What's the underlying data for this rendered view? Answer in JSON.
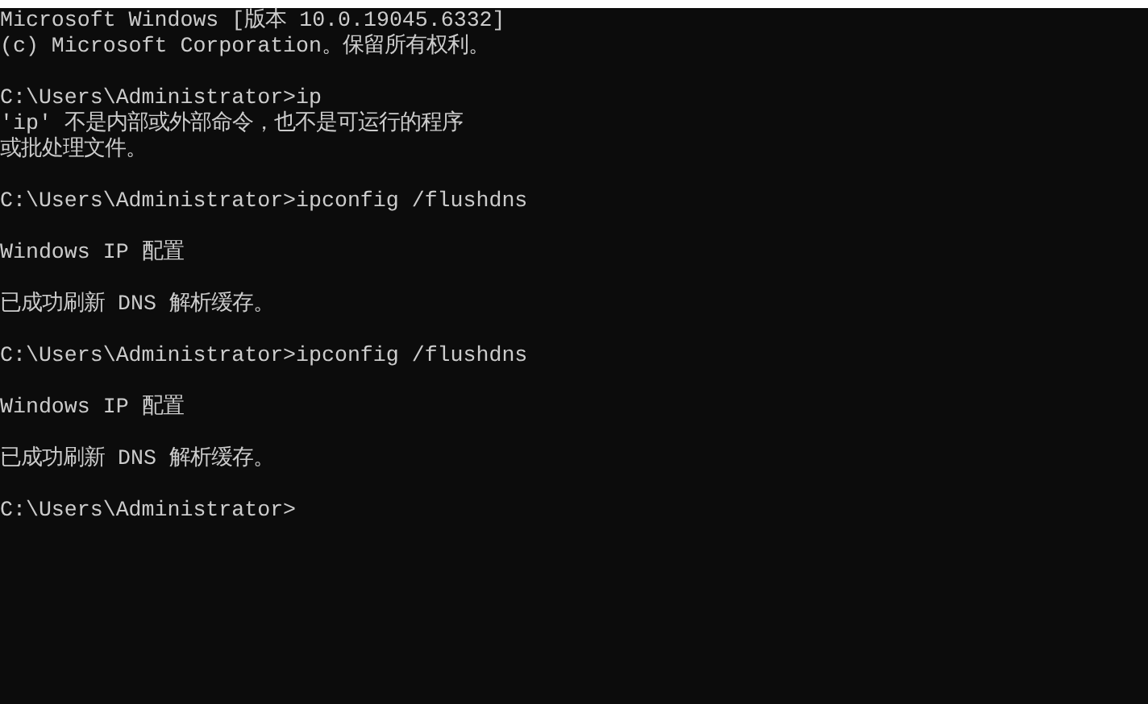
{
  "console": {
    "lines": [
      {
        "kind": "text",
        "text": "Microsoft Windows [版本 10.0.19045.6332]"
      },
      {
        "kind": "text",
        "text": "(c) Microsoft Corporation。保留所有权利。"
      },
      {
        "kind": "blank"
      },
      {
        "kind": "text",
        "text": "C:\\Users\\Administrator>ip"
      },
      {
        "kind": "text",
        "text": "'ip' 不是内部或外部命令，也不是可运行的程序"
      },
      {
        "kind": "text",
        "text": "或批处理文件。"
      },
      {
        "kind": "blank"
      },
      {
        "kind": "text",
        "text": "C:\\Users\\Administrator>ipconfig /flushdns"
      },
      {
        "kind": "blank"
      },
      {
        "kind": "text",
        "text": "Windows IP 配置"
      },
      {
        "kind": "blank"
      },
      {
        "kind": "text",
        "text": "已成功刷新 DNS 解析缓存。"
      },
      {
        "kind": "blank"
      },
      {
        "kind": "text",
        "text": "C:\\Users\\Administrator>ipconfig /flushdns"
      },
      {
        "kind": "blank"
      },
      {
        "kind": "text",
        "text": "Windows IP 配置"
      },
      {
        "kind": "blank"
      },
      {
        "kind": "text",
        "text": "已成功刷新 DNS 解析缓存。"
      },
      {
        "kind": "blank"
      },
      {
        "kind": "text",
        "text": "C:\\Users\\Administrator>"
      }
    ]
  }
}
